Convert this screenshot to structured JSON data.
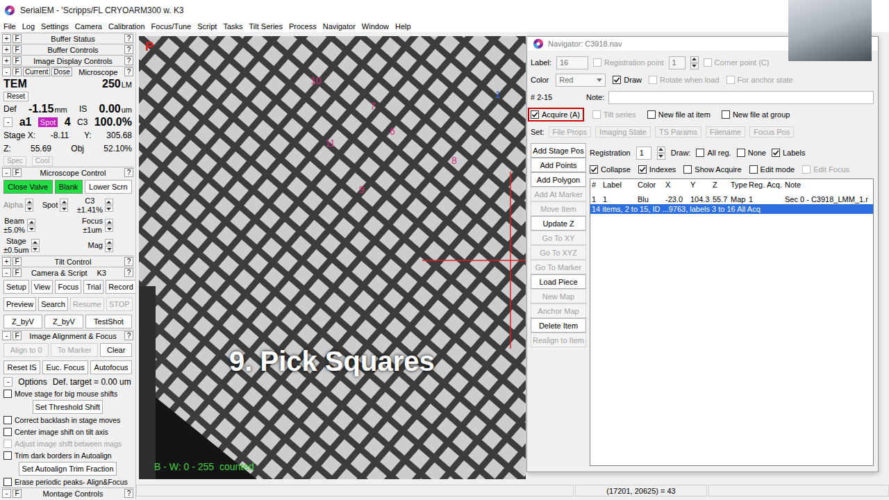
{
  "window": {
    "title": "SerialEM - 'Scripps/FL CRYOARM300 w. K3"
  },
  "menu": [
    "File",
    "Log",
    "Settings",
    "Camera",
    "Calibration",
    "Focus/Tune",
    "Script",
    "Tasks",
    "Tilt Series",
    "Process",
    "Navigator",
    "Window",
    "Help"
  ],
  "panel_keys": {
    "float": "F",
    "help": "?"
  },
  "left_panel": [
    {
      "kind": "header",
      "sign": "+",
      "title": "Buffer Status"
    },
    {
      "kind": "header",
      "sign": "+",
      "title": "Buffer Controls"
    },
    {
      "kind": "header",
      "sign": "+",
      "title": "Image Display Controls"
    },
    {
      "kind": "header",
      "sign": "-",
      "title": "Microscope",
      "extras": [
        "Current",
        "Dose"
      ]
    },
    {
      "kind": "readout",
      "cells": [
        {
          "kind": "value",
          "text": "TEM"
        },
        {
          "kind": "value",
          "text": "250",
          "unit": "LM"
        }
      ]
    },
    {
      "kind": "line",
      "cells": [
        {
          "kind": "button",
          "text": "Reset",
          "disabled": false
        }
      ]
    },
    {
      "kind": "readout",
      "cells": [
        {
          "kind": "label",
          "text": "Def"
        },
        {
          "kind": "value",
          "text": "-1.15",
          "unit": "mm"
        },
        {
          "kind": "label",
          "text": "IS"
        },
        {
          "kind": "value",
          "text": "0.00",
          "unit": "um"
        }
      ]
    },
    {
      "kind": "readout",
      "cells": [
        {
          "kind": "button",
          "text": "-",
          "disabled": false
        },
        {
          "kind": "value",
          "text": "a1"
        },
        {
          "kind": "badge",
          "text": "Spot"
        },
        {
          "kind": "value",
          "text": "4"
        },
        {
          "kind": "label",
          "text": "C3"
        },
        {
          "kind": "value",
          "text": "100.0%"
        }
      ]
    },
    {
      "kind": "readout",
      "cells": [
        {
          "kind": "label",
          "text": "Stage X:"
        },
        {
          "kind": "label",
          "text": "-8.11"
        },
        {
          "kind": "label",
          "text": "Y:"
        },
        {
          "kind": "label",
          "text": "305.68"
        }
      ]
    },
    {
      "kind": "readout",
      "cells": [
        {
          "kind": "label",
          "text": "Z:"
        },
        {
          "kind": "label",
          "text": "55.69"
        },
        {
          "kind": "label",
          "text": "Obj"
        },
        {
          "kind": "label",
          "text": "52.10%"
        }
      ]
    },
    {
      "kind": "line",
      "cells": [
        {
          "kind": "button",
          "text": "Spec",
          "disabled": true
        },
        {
          "kind": "button",
          "text": "Cool",
          "disabled": true
        }
      ]
    },
    {
      "kind": "header",
      "sign": "-",
      "title": "Microscope Control"
    },
    {
      "kind": "buttons",
      "cells": [
        {
          "kind": "button",
          "text": "Close Valve",
          "disabled": false,
          "active": true
        },
        {
          "kind": "button",
          "text": "Blank",
          "disabled": false,
          "active": true
        },
        {
          "kind": "button",
          "text": "Lower Scrn",
          "disabled": false,
          "active": false
        }
      ]
    },
    {
      "kind": "spins",
      "cells": [
        {
          "kind": "spin",
          "text": "Alpha",
          "disabled": true
        },
        {
          "kind": "spin",
          "text": "Spot",
          "disabled": false
        },
        {
          "kind": "spin",
          "text": "C3",
          "sub": "±1.41%",
          "disabled": false
        }
      ]
    },
    {
      "kind": "spins",
      "cells": [
        {
          "kind": "spin",
          "text": "Beam",
          "sub": "±5.0%",
          "disabled": false
        },
        {
          "kind": "spin",
          "text": "Focus",
          "sub": "±1um",
          "disabled": false
        }
      ]
    },
    {
      "kind": "spins",
      "cells": [
        {
          "kind": "spin",
          "text": "Stage",
          "sub": "±0.5um",
          "disabled": false
        },
        {
          "kind": "spin",
          "text": "Mag",
          "disabled": false
        }
      ]
    },
    {
      "kind": "header",
      "sign": "+",
      "title": "Tilt Control"
    },
    {
      "kind": "header",
      "sign": "-",
      "title": "Camera & Script",
      "tag": "K3"
    },
    {
      "kind": "buttons",
      "cells": [
        {
          "kind": "button",
          "text": "Setup",
          "disabled": false
        },
        {
          "kind": "button",
          "text": "View",
          "disabled": false
        },
        {
          "kind": "button",
          "text": "Focus",
          "disabled": false
        },
        {
          "kind": "button",
          "text": "Trial",
          "disabled": false
        },
        {
          "kind": "button",
          "text": "Record",
          "disabled": false
        }
      ]
    },
    {
      "kind": "buttons",
      "cells": [
        {
          "kind": "button",
          "text": "Preview",
          "disabled": false
        },
        {
          "kind": "button",
          "text": "Search",
          "disabled": false
        },
        {
          "kind": "button",
          "text": "Resume",
          "disabled": true
        },
        {
          "kind": "button",
          "text": "STOP",
          "disabled": true
        }
      ]
    },
    {
      "kind": "buttons",
      "cells": [
        {
          "kind": "button",
          "text": "Z_byV",
          "disabled": false
        },
        {
          "kind": "button",
          "text": "Z_byV",
          "disabled": false
        },
        {
          "kind": "button",
          "text": "TestShot",
          "disabled": false
        }
      ]
    },
    {
      "kind": "header",
      "sign": "-",
      "title": "Image Alignment & Focus"
    },
    {
      "kind": "buttons",
      "cells": [
        {
          "kind": "button",
          "text": "Align to 0",
          "disabled": true
        },
        {
          "kind": "button",
          "text": "To Marker",
          "disabled": true
        },
        {
          "kind": "button",
          "text": "Clear",
          "disabled": false
        }
      ]
    },
    {
      "kind": "buttons",
      "cells": [
        {
          "kind": "button",
          "text": "Reset IS",
          "disabled": false
        },
        {
          "kind": "button",
          "text": "Euc. Focus",
          "disabled": false
        },
        {
          "kind": "button",
          "text": "Autofocus",
          "disabled": false
        }
      ]
    },
    {
      "kind": "line",
      "cells": [
        {
          "kind": "button",
          "text": "-",
          "disabled": false
        },
        {
          "kind": "label",
          "text": "Options"
        },
        {
          "kind": "label",
          "text": "Def. target = 0.00 um"
        }
      ]
    },
    {
      "kind": "checks",
      "cells": [
        {
          "kind": "check",
          "text": "Move stage for big mouse shifts",
          "checked": false,
          "disabled": false
        }
      ]
    },
    {
      "kind": "center",
      "cells": [
        {
          "kind": "button",
          "text": "Set Threshold Shift",
          "disabled": false
        }
      ]
    },
    {
      "kind": "checks",
      "cells": [
        {
          "kind": "check",
          "text": "Correct backlash in stage moves",
          "checked": false,
          "disabled": false
        }
      ]
    },
    {
      "kind": "checks",
      "cells": [
        {
          "kind": "check",
          "text": "Center image shift on tilt axis",
          "checked": false,
          "disabled": false
        }
      ]
    },
    {
      "kind": "checks",
      "cells": [
        {
          "kind": "check",
          "text": "Adjust image shift between mags",
          "checked": false,
          "disabled": true
        }
      ]
    },
    {
      "kind": "checks",
      "cells": [
        {
          "kind": "check",
          "text": "Trim dark borders in Autoalign",
          "checked": false,
          "disabled": false
        }
      ]
    },
    {
      "kind": "center",
      "cells": [
        {
          "kind": "button",
          "text": "Set Autoalign Trim Fraction",
          "disabled": false
        }
      ]
    },
    {
      "kind": "checks",
      "cells": [
        {
          "kind": "check",
          "text": "Erase periodic peaks- Align&Focus",
          "checked": false,
          "disabled": false
        }
      ]
    },
    {
      "kind": "header",
      "sign": "-",
      "title": "Montage Controls"
    }
  ],
  "image": {
    "marker": "P",
    "labels": [
      {
        "text": "10",
        "color": "#cc3377"
      },
      {
        "text": "7",
        "color": "#cc3377"
      },
      {
        "text": "6",
        "color": "#cc3377"
      },
      {
        "text": "11",
        "color": "#cc3377"
      },
      {
        "text": "8",
        "color": "#cc3377"
      },
      {
        "text": "9",
        "color": "#cc3377"
      },
      {
        "text": "1",
        "color": "#2f6fd6"
      }
    ],
    "display_range": "B - W: 0 - 255  counted",
    "caption": "9. Pick Squares"
  },
  "navigator": {
    "title": "Navigator: C3918.nav",
    "label_caption": "Label:",
    "label_field": {
      "value": "16",
      "disabled": true
    },
    "registration_point": {
      "text": "Registration point",
      "checked": false,
      "disabled": true
    },
    "reg_point_field": {
      "value": "1",
      "disabled": true
    },
    "corner_point": {
      "text": "Corner point (C)",
      "checked": false,
      "disabled": true
    },
    "color_caption": "Color",
    "color_select": {
      "value": "Red",
      "disabled": true
    },
    "draw": {
      "text": "Draw",
      "checked": true,
      "disabled": false
    },
    "rotate": {
      "text": "Rotate when load",
      "checked": false,
      "disabled": true
    },
    "anchor": {
      "text": "For anchor state",
      "checked": false,
      "disabled": true
    },
    "index_text": "# 2-15",
    "note_caption": "Note:",
    "acquire_options": [
      {
        "text": "Acquire (A)",
        "checked": true,
        "disabled": false,
        "highlighted": true
      },
      {
        "text": "Tilt series",
        "checked": false,
        "disabled": true,
        "highlighted": false
      },
      {
        "text": "New file at item",
        "checked": false,
        "disabled": false,
        "highlighted": false
      },
      {
        "text": "New file at group",
        "checked": false,
        "disabled": false,
        "highlighted": false
      }
    ],
    "set_caption": "Set:",
    "set_buttons": [
      {
        "text": "File Props",
        "disabled": true
      },
      {
        "text": "Imaging State",
        "disabled": true
      },
      {
        "text": "TS Params",
        "disabled": true
      },
      {
        "text": "Filename",
        "disabled": true
      },
      {
        "text": "Focus Pos",
        "disabled": true
      }
    ],
    "buttons": [
      {
        "text": "Add Stage Pos",
        "disabled": false
      },
      {
        "text": "Add Points",
        "disabled": false
      },
      {
        "text": "Add Polygon",
        "disabled": false
      },
      {
        "text": "Add At Marker",
        "disabled": true
      },
      {
        "text": "Move Item",
        "disabled": true
      },
      {
        "text": "Update Z",
        "disabled": false
      },
      {
        "text": "Go To XY",
        "disabled": true
      },
      {
        "text": "Go To XYZ",
        "disabled": true
      },
      {
        "text": "Go To Marker",
        "disabled": true
      },
      {
        "text": "Load Piece",
        "disabled": false
      },
      {
        "text": "New Map",
        "disabled": true
      },
      {
        "text": "Anchor Map",
        "disabled": true
      },
      {
        "text": "Delete Item",
        "disabled": false
      },
      {
        "text": "Realign to Item",
        "disabled": true
      }
    ],
    "registration_caption": "Registration",
    "registration_field": {
      "value": "1",
      "disabled": false
    },
    "draw_caption": "Draw:",
    "draw_options": [
      {
        "text": "All reg.",
        "checked": false,
        "disabled": false
      },
      {
        "text": "None",
        "checked": false,
        "disabled": false
      },
      {
        "text": "Labels",
        "checked": true,
        "disabled": false
      }
    ],
    "view_options": [
      {
        "text": "Collapse",
        "checked": true,
        "disabled": false
      },
      {
        "text": "Indexes",
        "checked": true,
        "disabled": false
      },
      {
        "text": "Show Acquire",
        "checked": false,
        "disabled": false
      },
      {
        "text": "Edit mode",
        "checked": false,
        "disabled": false
      },
      {
        "text": "Edit Focus",
        "checked": false,
        "disabled": true
      }
    ],
    "columns": [
      "#",
      "Label",
      "Color",
      "X",
      "Y",
      "Z",
      "Type",
      "Reg.",
      "Acq.",
      "Note"
    ],
    "items": [
      {
        "kind": "item",
        "selected": false,
        "cells": [
          "1",
          "1",
          "Blu",
          "-23.0",
          "104.3",
          "55.7",
          "Map",
          "1",
          "",
          "Sec 0 - C3918_LMM_1.r"
        ]
      },
      {
        "kind": "group",
        "selected": true,
        "text": "14 items, 2 to 15, ID ...9763, labels 3 to 16  All Acq"
      }
    ]
  },
  "status_bar": {
    "text": "(17201, 20625) = 43"
  }
}
